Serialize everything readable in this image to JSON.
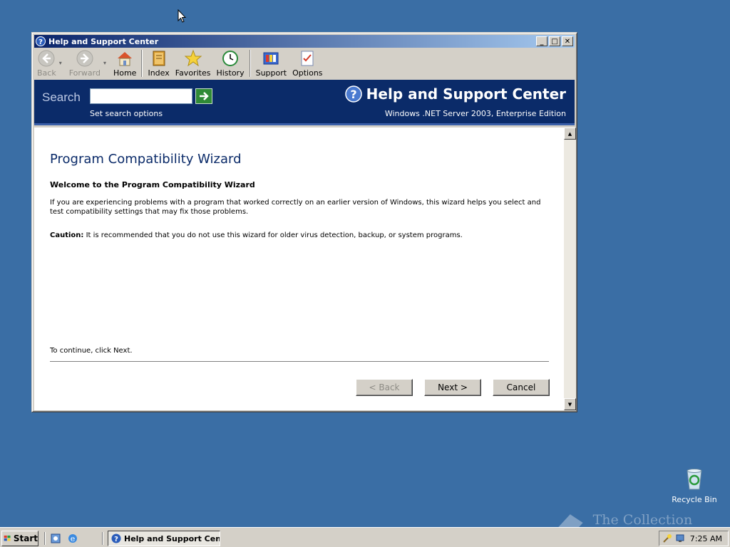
{
  "window": {
    "title": "Help and Support Center",
    "controls": {
      "minimize": "_",
      "maximize": "□",
      "close": "✕"
    }
  },
  "toolbar": {
    "items": [
      {
        "label": "Back",
        "icon": "back-arrow-icon",
        "enabled": false,
        "dropdown": true
      },
      {
        "label": "Forward",
        "icon": "forward-arrow-icon",
        "enabled": false,
        "dropdown": true
      },
      {
        "label": "Home",
        "icon": "home-icon",
        "enabled": true
      },
      {
        "label": "Index",
        "icon": "index-book-icon",
        "enabled": true
      },
      {
        "label": "Favorites",
        "icon": "star-icon",
        "enabled": true
      },
      {
        "label": "History",
        "icon": "history-clock-icon",
        "enabled": true
      },
      {
        "label": "Support",
        "icon": "support-icon",
        "enabled": true
      },
      {
        "label": "Options",
        "icon": "options-checklist-icon",
        "enabled": true
      }
    ]
  },
  "search": {
    "label": "Search",
    "value": "",
    "options_link": "Set search options"
  },
  "header": {
    "title": "Help and Support Center",
    "edition": "Windows .NET Server 2003, Enterprise Edition"
  },
  "wizard": {
    "title": "Program Compatibility Wizard",
    "welcome": "Welcome to the Program Compatibility Wizard",
    "description": "If you are experiencing problems with a program that worked correctly on an earlier version of Windows, this wizard helps you select and test compatibility settings that may fix those problems.",
    "caution_label": "Caution:",
    "caution_text": " It is recommended that you do not use this wizard for older virus detection, backup, or system programs.",
    "continue_text": "To continue, click Next.",
    "buttons": {
      "back": "< Back",
      "next": "Next >",
      "cancel": "Cancel"
    }
  },
  "desktop": {
    "recycle_bin": "Recycle Bin",
    "watermark": "The Collection Book"
  },
  "taskbar": {
    "start": "Start",
    "task": "Help and Support Cen...",
    "clock": "7:25 AM"
  },
  "colors": {
    "desktop": "#3a6ea5",
    "banner": "#0b2b69",
    "title_gradient_start": "#0a246a",
    "title_gradient_end": "#a6caf0"
  }
}
